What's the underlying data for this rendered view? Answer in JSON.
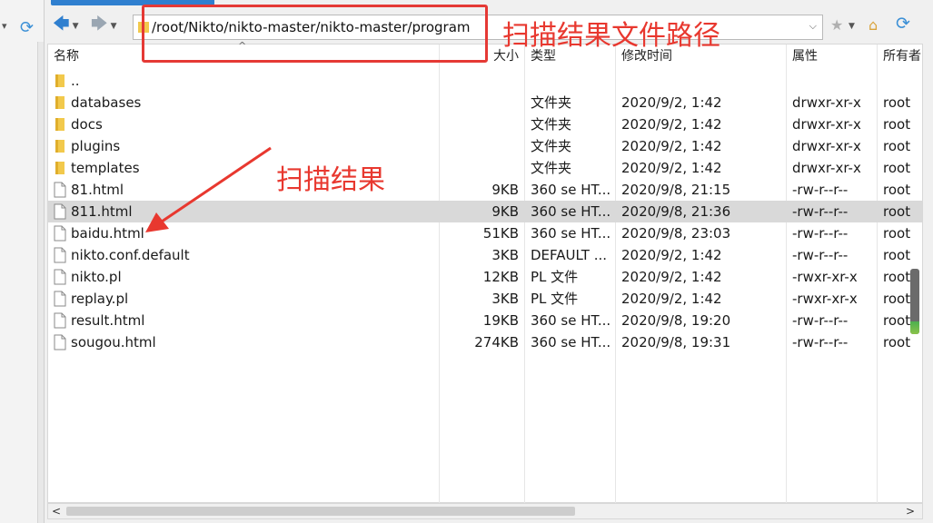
{
  "toolbar": {
    "path": "/root/Nikto/nikto-master/nikto-master/program",
    "back_icon": "back-arrow-icon",
    "forward_icon": "forward-arrow-icon"
  },
  "annotations": {
    "path_label": "扫描结果文件路径",
    "result_label": "扫描结果",
    "color": "#e8382f"
  },
  "columns": {
    "name": "名称",
    "size": "大小",
    "type": "类型",
    "modified": "修改时间",
    "attributes": "属性",
    "owner": "所有者"
  },
  "files": [
    {
      "name": "..",
      "size": "",
      "type": "",
      "modified": "",
      "attributes": "",
      "owner": "",
      "kind": "folder"
    },
    {
      "name": "databases",
      "size": "",
      "type": "文件夹",
      "modified": "2020/9/2, 1:42",
      "attributes": "drwxr-xr-x",
      "owner": "root",
      "kind": "folder"
    },
    {
      "name": "docs",
      "size": "",
      "type": "文件夹",
      "modified": "2020/9/2, 1:42",
      "attributes": "drwxr-xr-x",
      "owner": "root",
      "kind": "folder"
    },
    {
      "name": "plugins",
      "size": "",
      "type": "文件夹",
      "modified": "2020/9/2, 1:42",
      "attributes": "drwxr-xr-x",
      "owner": "root",
      "kind": "folder"
    },
    {
      "name": "templates",
      "size": "",
      "type": "文件夹",
      "modified": "2020/9/2, 1:42",
      "attributes": "drwxr-xr-x",
      "owner": "root",
      "kind": "folder"
    },
    {
      "name": "81.html",
      "size": "9KB",
      "type": "360 se HT...",
      "modified": "2020/9/8, 21:15",
      "attributes": "-rw-r--r--",
      "owner": "root",
      "kind": "file"
    },
    {
      "name": "811.html",
      "size": "9KB",
      "type": "360 se HT...",
      "modified": "2020/9/8, 21:36",
      "attributes": "-rw-r--r--",
      "owner": "root",
      "kind": "file",
      "selected": true
    },
    {
      "name": "baidu.html",
      "size": "51KB",
      "type": "360 se HT...",
      "modified": "2020/9/8, 23:03",
      "attributes": "-rw-r--r--",
      "owner": "root",
      "kind": "file"
    },
    {
      "name": "nikto.conf.default",
      "size": "3KB",
      "type": "DEFAULT ...",
      "modified": "2020/9/2, 1:42",
      "attributes": "-rw-r--r--",
      "owner": "root",
      "kind": "file"
    },
    {
      "name": "nikto.pl",
      "size": "12KB",
      "type": "PL 文件",
      "modified": "2020/9/2, 1:42",
      "attributes": "-rwxr-xr-x",
      "owner": "root",
      "kind": "file"
    },
    {
      "name": "replay.pl",
      "size": "3KB",
      "type": "PL 文件",
      "modified": "2020/9/2, 1:42",
      "attributes": "-rwxr-xr-x",
      "owner": "root",
      "kind": "file"
    },
    {
      "name": "result.html",
      "size": "19KB",
      "type": "360 se HT...",
      "modified": "2020/9/8, 19:20",
      "attributes": "-rw-r--r--",
      "owner": "root",
      "kind": "file"
    },
    {
      "name": "sougou.html",
      "size": "274KB",
      "type": "360 se HT...",
      "modified": "2020/9/8, 19:31",
      "attributes": "-rw-r--r--",
      "owner": "root",
      "kind": "file"
    }
  ],
  "icons": {
    "folder": "folder-icon",
    "file": "file-icon",
    "refresh": "refresh-icon",
    "star": "star-icon",
    "home": "home-icon"
  }
}
